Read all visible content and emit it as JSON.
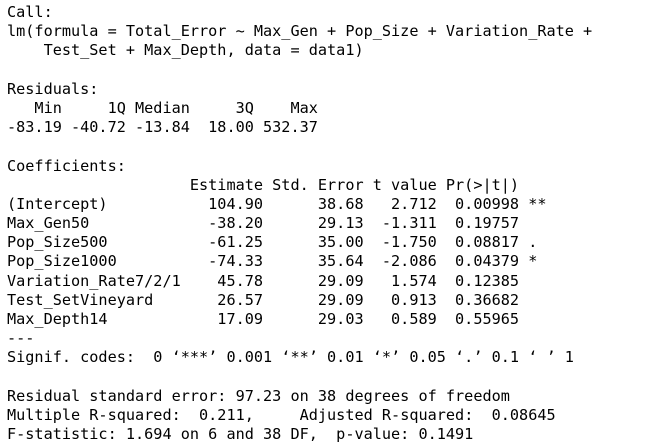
{
  "call": {
    "header": "Call:",
    "line1": "lm(formula = Total_Error ~ Max_Gen + Pop_Size + Variation_Rate +",
    "line2": "    Test_Set + Max_Depth, data = data1)"
  },
  "residuals": {
    "header": "Residuals:",
    "labels": "   Min     1Q Median     3Q    Max ",
    "values": "-83.19 -40.72 -13.84  18.00 532.37 "
  },
  "coefficients": {
    "header": "Coefficients:",
    "column_header": "                    Estimate Std. Error t value Pr(>|t|)   ",
    "rows": [
      "(Intercept)           104.90      38.68   2.712  0.00998 **",
      "Max_Gen50             -38.20      29.13  -1.311  0.19757   ",
      "Pop_Size500           -61.25      35.00  -1.750  0.08817 . ",
      "Pop_Size1000          -74.33      35.64  -2.086  0.04379 * ",
      "Variation_Rate7/2/1    45.78      29.09   1.574  0.12385   ",
      "Test_SetVineyard       26.57      29.09   0.913  0.36682   ",
      "Max_Depth14            17.09      29.03   0.589  0.55965   "
    ],
    "separator": "---",
    "signif": "Signif. codes:  0 ‘***’ 0.001 ‘**’ 0.01 ‘*’ 0.05 ‘.’ 0.1 ‘ ’ 1"
  },
  "summary": {
    "rse": "Residual standard error: 97.23 on 38 degrees of freedom",
    "r_squared": "Multiple R-squared:  0.211,\tAdjusted R-squared:  0.08645 ",
    "f_stat": "F-statistic: 1.694 on 6 and 38 DF,  p-value: 0.1491"
  }
}
